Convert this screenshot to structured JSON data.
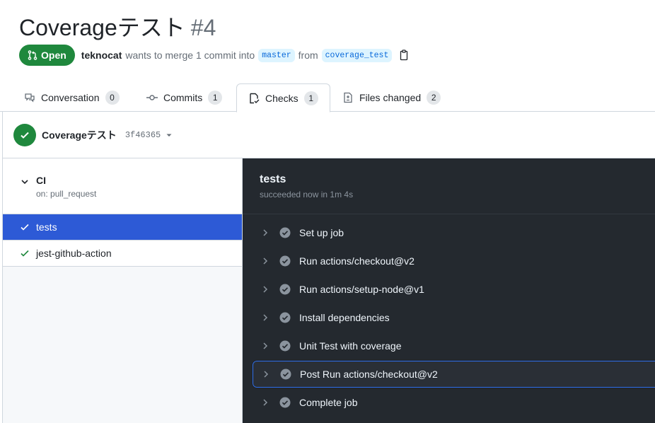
{
  "pr": {
    "title": "Coverageテスト",
    "number": "#4",
    "state": "Open",
    "author": "teknocat",
    "merge_text": "wants to merge 1 commit into",
    "base_branch": "master",
    "from_text": "from",
    "head_branch": "coverage_test"
  },
  "tabs": [
    {
      "label": "Conversation",
      "count": "0",
      "icon": "comment-icon"
    },
    {
      "label": "Commits",
      "count": "1",
      "icon": "commit-icon"
    },
    {
      "label": "Checks",
      "count": "1",
      "icon": "checklist-icon",
      "active": true
    },
    {
      "label": "Files changed",
      "count": "2",
      "icon": "file-diff-icon"
    }
  ],
  "check_summary": {
    "name": "Coverageテスト",
    "sha": "3f46365",
    "status_color": "#1f883d"
  },
  "workflow": {
    "name": "CI",
    "trigger": "on: pull_request",
    "jobs": [
      {
        "label": "tests",
        "selected": true
      },
      {
        "label": "jest-github-action",
        "selected": false
      }
    ]
  },
  "log": {
    "title": "tests",
    "subtitle": "succeeded now in 1m 4s",
    "steps": [
      {
        "label": "Set up job"
      },
      {
        "label": "Run actions/checkout@v2"
      },
      {
        "label": "Run actions/setup-node@v1"
      },
      {
        "label": "Install dependencies"
      },
      {
        "label": "Unit Test with coverage"
      },
      {
        "label": "Post Run actions/checkout@v2",
        "focused": true
      },
      {
        "label": "Complete job"
      }
    ]
  },
  "colors": {
    "accent_green": "#1f883d",
    "selected_blue": "#2d5ad6",
    "log_bg": "#24292f"
  }
}
